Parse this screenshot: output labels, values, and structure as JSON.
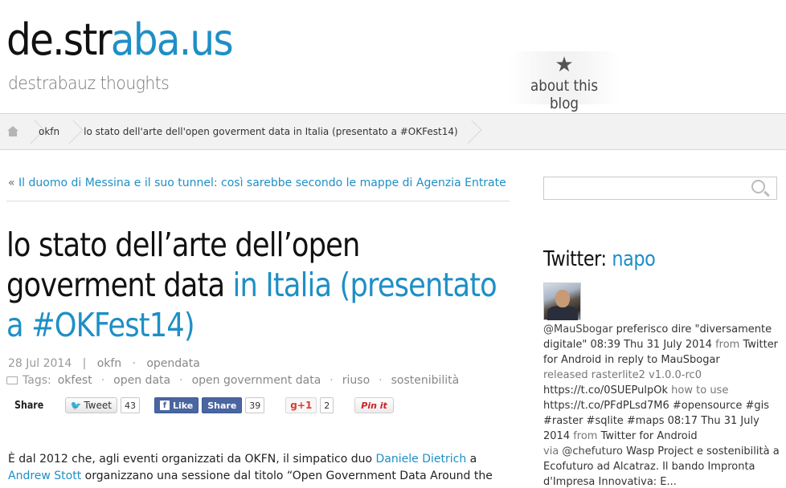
{
  "header": {
    "title_part1": "de.str",
    "title_part2": "aba.us",
    "tagline": "destrabauz thoughts",
    "about_icon": "star-icon",
    "about_label": "about this blog"
  },
  "breadcrumb": {
    "home_icon": "home-icon",
    "items": [
      "okfn",
      "lo stato dell'arte dell'open goverment data in Italia (presentato a #OKFest14)"
    ]
  },
  "post": {
    "prev_raquo": "«",
    "prev_link": "Il duomo di Messina e il suo tunnel: così sarebbe secondo le mappe di Agenzia Entrate",
    "title_part1": "lo stato dell’arte dell’open goverment data",
    "title_part2": "in Italia (presentato a #OKFest14)",
    "date": "28 Jul 2014",
    "meta_sep": "|",
    "categories": [
      "okfn",
      "opendata"
    ],
    "tags_label": "Tags:",
    "tags": [
      "okfest",
      "open data",
      "open government data",
      "riuso",
      "sostenibilità"
    ],
    "body_1": "È dal 2012 che, agli eventi organizzati da OKFN, il simpatico duo ",
    "body_link1": "Daniele Dietrich",
    "body_2": " a",
    "body_link2": "Andrew Stott",
    "body_3": " organizzano una sessione dal titolo “Open Government Data Around the"
  },
  "share": {
    "label": "Share",
    "tweet_label": "Tweet",
    "tweet_count": "43",
    "like_label": "Like",
    "fb_share_label": "Share",
    "fb_count": "39",
    "gplus_label": "g+1",
    "gplus_count": "2",
    "pin_label": "Pin it"
  },
  "sidebar": {
    "search_placeholder": "",
    "twitter_heading": "Twitter:",
    "twitter_user": "napo",
    "tweets": [
      {
        "user": "@MauSbogar",
        "text": " preferisco dire \"diversamente digitale\" 08:39 Thu 31 July 2014 ",
        "from": "from",
        "client": " Twitter for Android ",
        "reply": "in reply to MauSbogar"
      },
      {
        "text": "released rasterlite2 v1.0.0-rc0"
      },
      {
        "text": "https://t.co/0SUEPulpOk",
        "muted": " how to use"
      },
      {
        "text": "https://t.co/PFdPLsd7M6 #opensource #gis #raster #sqlite #maps 08:17 Thu 31 July 2014 ",
        "from": "from",
        "client": " Twitter for Android"
      },
      {
        "via": "via",
        "user": " @chefuturo",
        "text": " Wasp Project e sostenibilità a Ecofuturo ad Alcatraz. Il bando Impronta d'Impresa Innovativa: E..."
      }
    ]
  },
  "colors": {
    "accent": "#1e8fc6",
    "breadcrumb_bg": "#f2f2f2",
    "facebook": "#4a66a0",
    "pinterest": "#cb2027",
    "gplus": "#d73d32"
  }
}
